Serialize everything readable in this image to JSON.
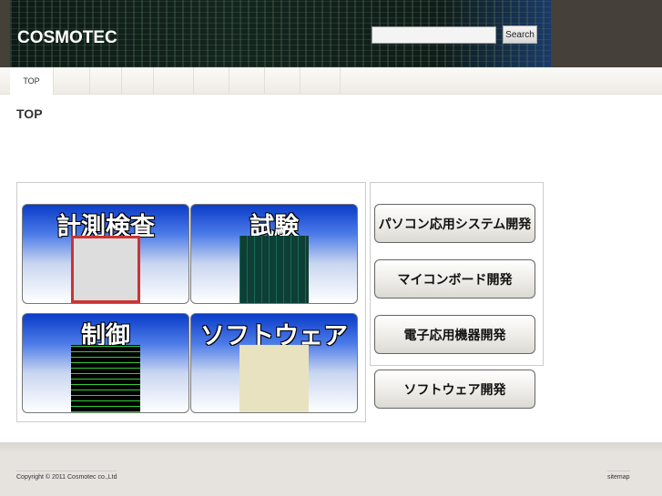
{
  "header": {
    "logo": "COSMOTEC",
    "search_placeholder": "",
    "search_button": "Search"
  },
  "nav": {
    "items": [
      {
        "label": "TOP"
      },
      {
        "label": ""
      },
      {
        "label": ""
      },
      {
        "label": ""
      },
      {
        "label": ""
      },
      {
        "label": ""
      },
      {
        "label": ""
      },
      {
        "label": ""
      },
      {
        "label": ""
      }
    ]
  },
  "main": {
    "title": "TOP",
    "tiles": [
      {
        "label": "計測検査"
      },
      {
        "label": "試験"
      },
      {
        "label": "制御"
      },
      {
        "label": "ソフトウェア"
      }
    ],
    "links": [
      {
        "label": "パソコン応用システム開発"
      },
      {
        "label": "マイコンボード開発"
      },
      {
        "label": "電子応用機器開発"
      },
      {
        "label": "ソフトウェア開発"
      }
    ]
  },
  "footer": {
    "copyright": "Copyright © 2011 Cosmotec co.,Ltd",
    "sitemap": "sitemap"
  }
}
